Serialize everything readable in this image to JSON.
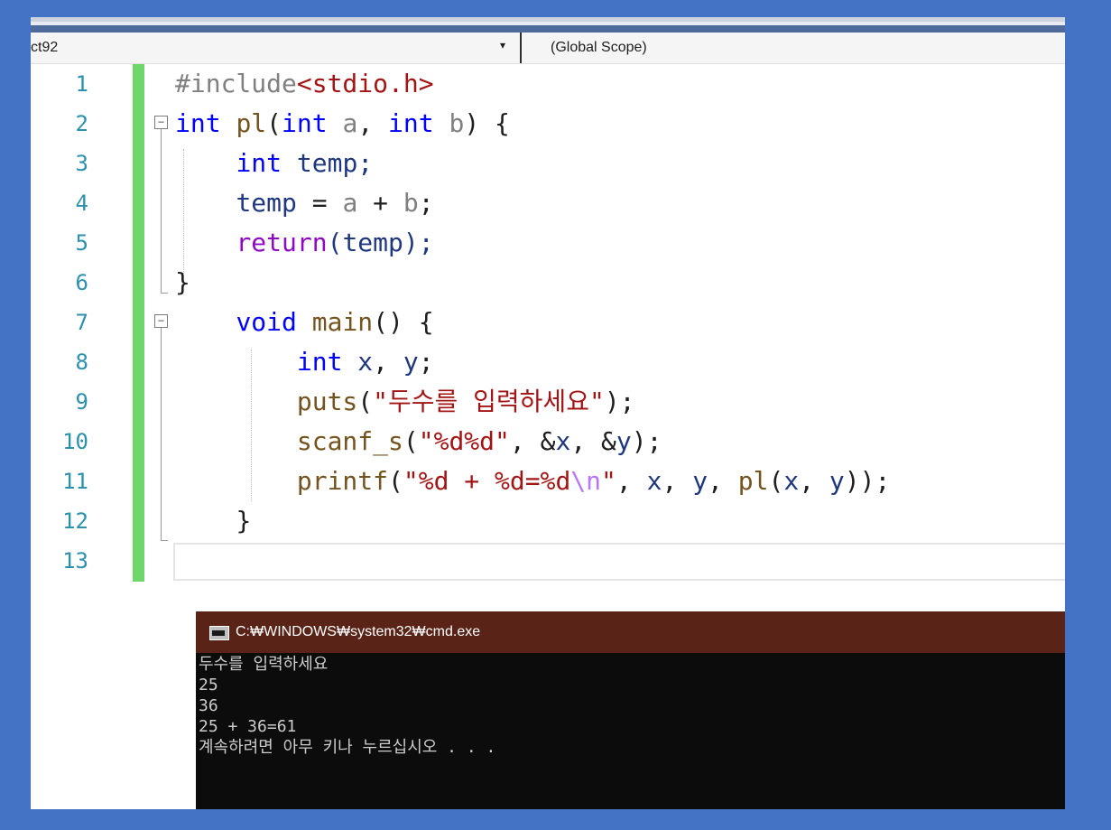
{
  "navbar": {
    "project": "ct92",
    "scope": "(Global Scope)"
  },
  "line_numbers": [
    "1",
    "2",
    "3",
    "4",
    "5",
    "6",
    "7",
    "8",
    "9",
    "10",
    "11",
    "12",
    "13"
  ],
  "code": {
    "l1": {
      "directive": "#include",
      "header": "<stdio.h>"
    },
    "l2": {
      "kw1": "int",
      "name": "pl",
      "open": "(",
      "kw2": "int",
      "p1": "a",
      "comma": ", ",
      "kw3": "int",
      "p2": "b",
      "close": ") {"
    },
    "l3": {
      "kw": "int",
      "rest": " temp;"
    },
    "l4": {
      "lhs": "temp",
      "eq": " = ",
      "a": "a",
      "plus": " + ",
      "b": "b",
      "semi": ";"
    },
    "l5": {
      "kw": "return",
      "rest": "(temp);"
    },
    "l6": {
      "text": "}"
    },
    "l7": {
      "kw": "void",
      "name": "main",
      "rest": "() {"
    },
    "l8": {
      "kw": "int",
      "x": "x",
      "comma": ", ",
      "y": "y",
      "semi": ";"
    },
    "l9": {
      "fn": "puts",
      "open": "(",
      "str": "\"두수를 입력하세요\"",
      "close": ");"
    },
    "l10": {
      "fn": "scanf_s",
      "open": "(",
      "str": "\"%d%d\"",
      "mid": ", &",
      "x": "x",
      "mid2": ", &",
      "y": "y",
      "close": ");"
    },
    "l11": {
      "fn": "printf",
      "open": "(",
      "str1": "\"%d + %d=%d",
      "esc": "\\n",
      "str2": "\"",
      "c1": ", ",
      "x": "x",
      "c2": ", ",
      "y": "y",
      "c3": ", ",
      "call": "pl",
      "o2": "(",
      "x2": "x",
      "c4": ", ",
      "y2": "y",
      "close": "));"
    },
    "l12": {
      "text": "}"
    }
  },
  "console": {
    "title": "C:₩WINDOWS₩system32₩cmd.exe",
    "lines": [
      "두수를 입력하세요",
      "25",
      "36",
      "25 + 36=61",
      "계속하려면 아무 키나 누르십시오 . . ."
    ]
  },
  "colors": {
    "background": "#4472c4",
    "keyword": "#0000ff",
    "string": "#a31515",
    "function": "#74531f",
    "line_number": "#2b91af",
    "console_title": "#5a2317"
  },
  "icons": [
    "fold-toggle-icon",
    "dropdown-arrow-icon",
    "console-app-icon"
  ]
}
